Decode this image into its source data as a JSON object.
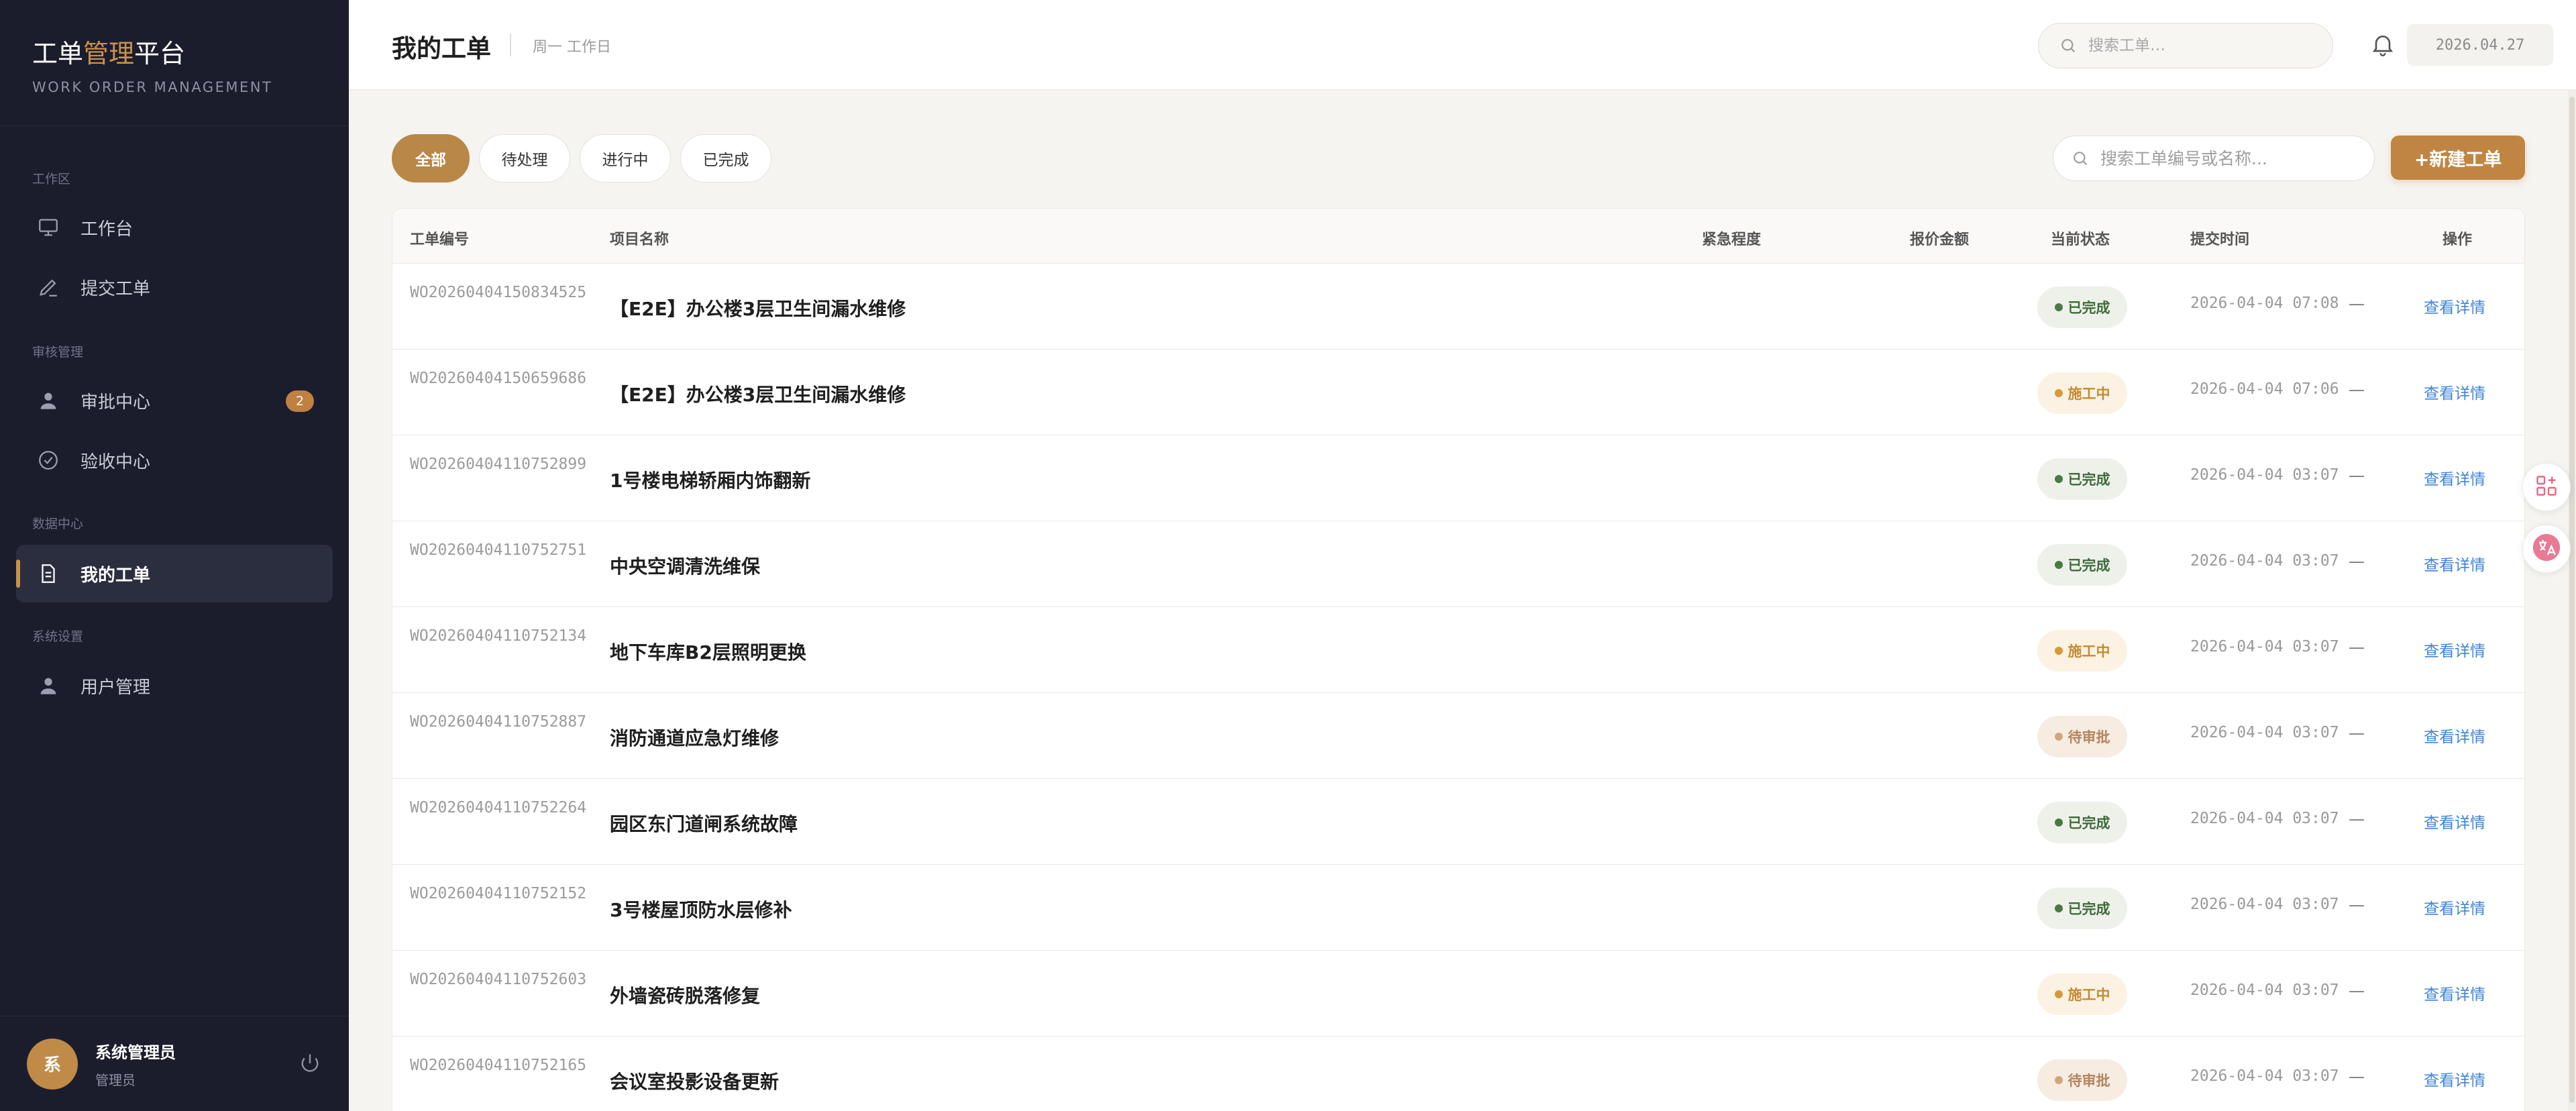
{
  "app": {
    "brand_part1": "工单",
    "brand_accent": "管理",
    "brand_part2": "平台",
    "brand_subtitle": "WORK ORDER MANAGEMENT"
  },
  "sidebar": {
    "sections": [
      {
        "label": "工作区"
      },
      {
        "label": "审核管理"
      },
      {
        "label": "数据中心"
      },
      {
        "label": "系统设置"
      }
    ],
    "items": [
      {
        "label": "工作台",
        "icon": "monitor-icon"
      },
      {
        "label": "提交工单",
        "icon": "pen-icon"
      },
      {
        "label": "审批中心",
        "icon": "user-icon",
        "badge": "2"
      },
      {
        "label": "验收中心",
        "icon": "check-circle-icon"
      },
      {
        "label": "我的工单",
        "icon": "document-icon",
        "active": true
      },
      {
        "label": "用户管理",
        "icon": "user-icon"
      }
    ],
    "user": {
      "avatar_text": "系",
      "name": "系统管理员",
      "role": "管理员"
    }
  },
  "header": {
    "title": "我的工单",
    "day_text": "周一 工作日",
    "search_placeholder": "搜索工单…",
    "date": "2026.04.27"
  },
  "filters": {
    "tabs": [
      {
        "label": "全部",
        "active": true
      },
      {
        "label": "待处理"
      },
      {
        "label": "进行中"
      },
      {
        "label": "已完成"
      }
    ],
    "search_placeholder": "搜索工单编号或名称...",
    "new_button": "+新建工单"
  },
  "table": {
    "columns": [
      "工单编号",
      "项目名称",
      "紧急程度",
      "报价金额",
      "当前状态",
      "提交时间",
      "操作"
    ],
    "rows": [
      {
        "id": "WO20260404150834525",
        "name": "【E2E】办公楼3层卫生间漏水维修",
        "amount": "—",
        "status": "已完成",
        "status_type": "done",
        "time": "2026-04-04 07:08",
        "action": "查看详情"
      },
      {
        "id": "WO20260404150659686",
        "name": "【E2E】办公楼3层卫生间漏水维修",
        "amount": "—",
        "status": "施工中",
        "status_type": "working",
        "time": "2026-04-04 07:06",
        "action": "查看详情"
      },
      {
        "id": "WO20260404110752899",
        "name": "1号楼电梯轿厢内饰翻新",
        "amount": "—",
        "status": "已完成",
        "status_type": "done",
        "time": "2026-04-04 03:07",
        "action": "查看详情"
      },
      {
        "id": "WO20260404110752751",
        "name": "中央空调清洗维保",
        "amount": "—",
        "status": "已完成",
        "status_type": "done",
        "time": "2026-04-04 03:07",
        "action": "查看详情"
      },
      {
        "id": "WO20260404110752134",
        "name": "地下车库B2层照明更换",
        "amount": "—",
        "status": "施工中",
        "status_type": "working",
        "time": "2026-04-04 03:07",
        "action": "查看详情"
      },
      {
        "id": "WO20260404110752887",
        "name": "消防通道应急灯维修",
        "amount": "—",
        "status": "待审批",
        "status_type": "pending",
        "time": "2026-04-04 03:07",
        "action": "查看详情"
      },
      {
        "id": "WO20260404110752264",
        "name": "园区东门道闸系统故障",
        "amount": "—",
        "status": "已完成",
        "status_type": "done",
        "time": "2026-04-04 03:07",
        "action": "查看详情"
      },
      {
        "id": "WO20260404110752152",
        "name": "3号楼屋顶防水层修补",
        "amount": "—",
        "status": "已完成",
        "status_type": "done",
        "time": "2026-04-04 03:07",
        "action": "查看详情"
      },
      {
        "id": "WO20260404110752603",
        "name": "外墙瓷砖脱落修复",
        "amount": "—",
        "status": "施工中",
        "status_type": "working",
        "time": "2026-04-04 03:07",
        "action": "查看详情"
      },
      {
        "id": "WO20260404110752165",
        "name": "会议室投影设备更新",
        "amount": "—",
        "status": "待审批",
        "status_type": "pending",
        "time": "2026-04-04 03:07",
        "action": "查看详情"
      }
    ]
  },
  "colors": {
    "accent": "#c08542",
    "sidebar_bg": "#1b1d2c",
    "link": "#3f84d8",
    "status_done": "#3f6b3a",
    "status_working": "#c58a2f",
    "status_pending": "#b48560"
  }
}
